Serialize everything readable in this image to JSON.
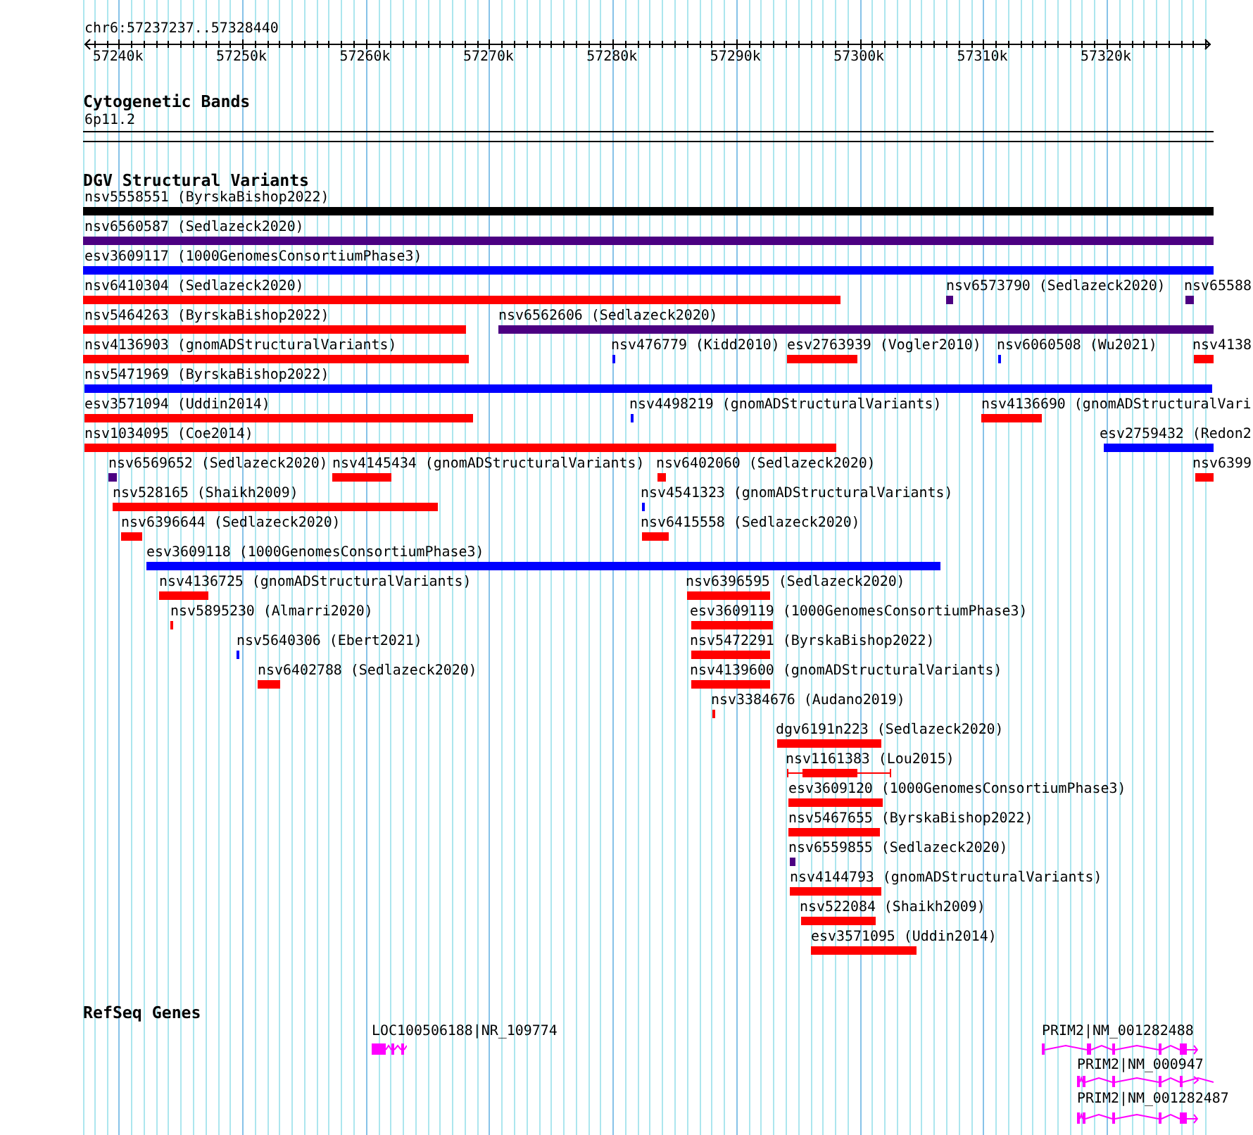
{
  "ruler": {
    "range": "chr6:57237237..57328440",
    "ticks": [
      "57240k",
      "57250k",
      "57260k",
      "57270k",
      "57280k",
      "57290k",
      "57300k",
      "57310k",
      "57320k"
    ]
  },
  "cytogenetic_bands": {
    "title": "Cytogenetic Bands",
    "band": "6p11.2"
  },
  "dgv_structural_variants": {
    "title": "DGV Structural Variants",
    "variants": [
      {
        "label": "nsv5558551 (ByrskaBishop2022)",
        "color": "#000000",
        "kind": "bar"
      },
      {
        "label": "nsv6560587 (Sedlazeck2020)",
        "color": "#4b0082",
        "kind": "bar"
      },
      {
        "label": "esv3609117 (1000GenomesConsortiumPhase3)",
        "color": "#0000ff",
        "kind": "bar"
      },
      {
        "label": "nsv6410304 (Sedlazeck2020)",
        "color": "#ff0000",
        "kind": "bar"
      },
      {
        "label": "nsv6573790 (Sedlazeck2020)",
        "color": "#4b0082",
        "kind": "bar"
      },
      {
        "label": "nsv65588",
        "color": "#4b0082",
        "kind": "bar"
      },
      {
        "label": "nsv5464263 (ByrskaBishop2022)",
        "color": "#ff0000",
        "kind": "bar"
      },
      {
        "label": "nsv6562606 (Sedlazeck2020)",
        "color": "#4b0082",
        "kind": "bar"
      },
      {
        "label": "nsv4136903 (gnomADStructuralVariants)",
        "color": "#ff0000",
        "kind": "bar"
      },
      {
        "label": "nsv476779 (Kidd2010)",
        "color": "#0000ff",
        "kind": "bar"
      },
      {
        "label": "esv2763939 (Vogler2010)",
        "color": "#ff0000",
        "kind": "bar"
      },
      {
        "label": "nsv6060508 (Wu2021)",
        "color": "#0000ff",
        "kind": "bar"
      },
      {
        "label": "nsv4138",
        "color": "#ff0000",
        "kind": "bar"
      },
      {
        "label": "nsv5471969 (ByrskaBishop2022)",
        "color": "#0000ff",
        "kind": "bar"
      },
      {
        "label": "esv3571094 (Uddin2014)",
        "color": "#ff0000",
        "kind": "bar"
      },
      {
        "label": "nsv4498219 (gnomADStructuralVariants)",
        "color": "#0000ff",
        "kind": "bar"
      },
      {
        "label": "nsv4136690 (gnomADStructuralVari",
        "color": "#ff0000",
        "kind": "bar"
      },
      {
        "label": "nsv1034095 (Coe2014)",
        "color": "#ff0000",
        "kind": "bar"
      },
      {
        "label": "esv2759432 (Redon2",
        "color": "#0000ff",
        "kind": "bar"
      },
      {
        "label": "nsv6569652 (Sedlazeck2020)",
        "color": "#4b0082",
        "kind": "bar"
      },
      {
        "label": "nsv4145434 (gnomADStructuralVariants)",
        "color": "#ff0000",
        "kind": "bar"
      },
      {
        "label": "nsv6402060 (Sedlazeck2020)",
        "color": "#ff0000",
        "kind": "bar"
      },
      {
        "label": "nsv6399",
        "color": "#ff0000",
        "kind": "bar"
      },
      {
        "label": "nsv528165 (Shaikh2009)",
        "color": "#ff0000",
        "kind": "bar"
      },
      {
        "label": "nsv4541323 (gnomADStructuralVariants)",
        "color": "#0000ff",
        "kind": "bar"
      },
      {
        "label": "nsv6396644 (Sedlazeck2020)",
        "color": "#ff0000",
        "kind": "bar"
      },
      {
        "label": "nsv6415558 (Sedlazeck2020)",
        "color": "#ff0000",
        "kind": "bar"
      },
      {
        "label": "esv3609118 (1000GenomesConsortiumPhase3)",
        "color": "#0000ff",
        "kind": "bar"
      },
      {
        "label": "nsv4136725 (gnomADStructuralVariants)",
        "color": "#ff0000",
        "kind": "bar"
      },
      {
        "label": "nsv6396595 (Sedlazeck2020)",
        "color": "#ff0000",
        "kind": "bar"
      },
      {
        "label": "nsv5895230 (Almarri2020)",
        "color": "#ff0000",
        "kind": "bar"
      },
      {
        "label": "esv3609119 (1000GenomesConsortiumPhase3)",
        "color": "#ff0000",
        "kind": "bar"
      },
      {
        "label": "nsv5640306 (Ebert2021)",
        "color": "#0000ff",
        "kind": "bar"
      },
      {
        "label": "nsv5472291 (ByrskaBishop2022)",
        "color": "#ff0000",
        "kind": "bar"
      },
      {
        "label": "nsv6402788 (Sedlazeck2020)",
        "color": "#ff0000",
        "kind": "bar"
      },
      {
        "label": "nsv4139600 (gnomADStructuralVariants)",
        "color": "#ff0000",
        "kind": "bar"
      },
      {
        "label": "nsv3384676 (Audano2019)",
        "color": "#ff0000",
        "kind": "bar"
      },
      {
        "label": "dgv6191n223 (Sedlazeck2020)",
        "color": "#ff0000",
        "kind": "bar"
      },
      {
        "label": "nsv1161383 (Lou2015)",
        "color": "#ff0000",
        "kind": "range"
      },
      {
        "label": "esv3609120 (1000GenomesConsortiumPhase3)",
        "color": "#ff0000",
        "kind": "bar"
      },
      {
        "label": "nsv5467655 (ByrskaBishop2022)",
        "color": "#ff0000",
        "kind": "bar"
      },
      {
        "label": "nsv6559855 (Sedlazeck2020)",
        "color": "#4b0082",
        "kind": "bar"
      },
      {
        "label": "nsv4144793 (gnomADStructuralVariants)",
        "color": "#ff0000",
        "kind": "bar"
      },
      {
        "label": "nsv522084 (Shaikh2009)",
        "color": "#ff0000",
        "kind": "bar"
      },
      {
        "label": "esv3571095 (Uddin2014)",
        "color": "#ff0000",
        "kind": "bar"
      }
    ]
  },
  "refseq_genes": {
    "title": "RefSeq Genes",
    "genes": [
      {
        "label": "LOC100506188|NR_109774"
      },
      {
        "label": "PRIM2|NM_001282488"
      },
      {
        "label": "PRIM2|NM_000947"
      },
      {
        "label": "PRIM2|NM_001282487"
      }
    ]
  }
}
